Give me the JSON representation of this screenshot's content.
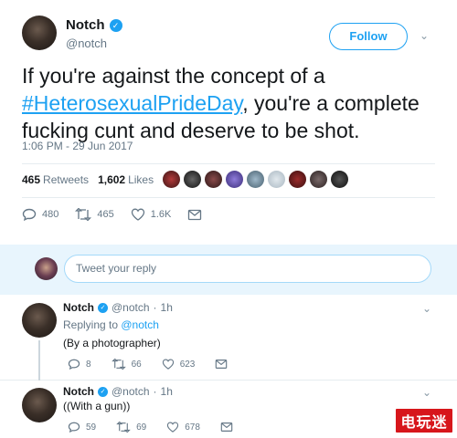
{
  "tweet": {
    "name": "Notch",
    "handle": "@notch",
    "follow_label": "Follow",
    "text_before": "If you're against the concept of a ",
    "hashtag": "#HeterosexualPrideDay",
    "text_after": ", you're a complete fucking cunt and deserve to be shot.",
    "timestamp": "1:06 PM - 29 Jun 2017",
    "retweets_count": "465",
    "retweets_label": "Retweets",
    "likes_count": "1,602",
    "likes_label": "Likes",
    "actions": {
      "replies": "480",
      "retweets": "465",
      "likes": "1.6K"
    }
  },
  "reply_box": {
    "placeholder": "Tweet your reply"
  },
  "replies": [
    {
      "name": "Notch",
      "handle": "@notch",
      "time": "1h",
      "replying_prefix": "Replying to ",
      "replying_to": "@notch",
      "text": "(By a photographer)",
      "actions": {
        "replies": "8",
        "retweets": "66",
        "likes": "623"
      }
    },
    {
      "name": "Notch",
      "handle": "@notch",
      "time": "1h",
      "text": "((With a gun))",
      "actions": {
        "replies": "59",
        "retweets": "69",
        "likes": "678"
      }
    }
  ],
  "watermark": {
    "text": "电玩迷"
  },
  "colors": {
    "accent": "#1da1f2",
    "muted": "#657786",
    "reply_bar_bg": "#e8f5fd",
    "watermark": "#d7161b"
  }
}
